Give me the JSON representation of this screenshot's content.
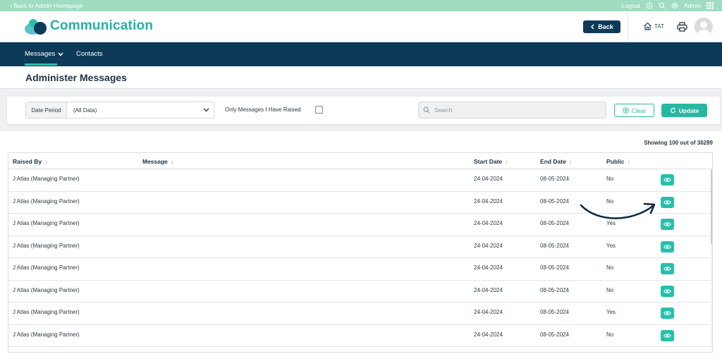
{
  "topbar": {
    "back_link": "‹ Back to Admin Homepage",
    "logout": "Logout",
    "user": "Admin"
  },
  "header": {
    "app_title": "Communication",
    "back_button": "Back",
    "home_label": "TAT"
  },
  "nav": {
    "items": [
      {
        "label": "Messages",
        "active": true
      },
      {
        "label": "Contacts",
        "active": false
      }
    ]
  },
  "page": {
    "title": "Administer Messages"
  },
  "filters": {
    "date_period_label": "Date Period",
    "date_period_value": "(All Data)",
    "only_mine_label": "Only Messages I Have Raised",
    "only_mine_checked": false,
    "search_placeholder": "Search",
    "clear_label": "Clear",
    "update_label": "Update"
  },
  "table": {
    "showing": "Showing 100 out of 36289",
    "columns": [
      "Raised By",
      "Message",
      "Start Date",
      "End Date",
      "Public"
    ],
    "rows": [
      {
        "raised_by": "J Atlas (Managing Partner)",
        "message": "",
        "start": "24-04-2024",
        "end": "08-05-2024",
        "public": "No"
      },
      {
        "raised_by": "J Atlas (Managing Partner)",
        "message": "",
        "start": "24-04-2024",
        "end": "08-05-2024",
        "public": "No"
      },
      {
        "raised_by": "J Atlas (Managing Partner)",
        "message": "",
        "start": "24-04-2024",
        "end": "08-05-2024",
        "public": "Yes"
      },
      {
        "raised_by": "J Atlas (Managing Partner)",
        "message": "",
        "start": "24-04-2024",
        "end": "08-05-2024",
        "public": "Yes"
      },
      {
        "raised_by": "J Atlas (Managing Partner)",
        "message": "",
        "start": "24-04-2024",
        "end": "08-05-2024",
        "public": "No"
      },
      {
        "raised_by": "J Atlas (Managing Partner)",
        "message": "",
        "start": "24-04-2024",
        "end": "08-05-2024",
        "public": "No"
      },
      {
        "raised_by": "J Atlas (Managing Partner)",
        "message": "",
        "start": "24-04-2024",
        "end": "08-05-2024",
        "public": "Yes"
      },
      {
        "raised_by": "J Atlas (Managing Partner)",
        "message": "",
        "start": "24-04-2024",
        "end": "08-05-2024",
        "public": "No"
      }
    ]
  },
  "icons": {
    "view_row": "eye-icon",
    "back": "chevron-left-icon",
    "home": "home-icon",
    "print": "printer-icon",
    "settings": "gear-icon",
    "search": "search-icon",
    "logout": "logout-icon",
    "apps": "grid-icon"
  },
  "colors": {
    "teal": "#27b8a2",
    "navy": "#0d3a58",
    "mint_bar": "#9fdcc2"
  }
}
